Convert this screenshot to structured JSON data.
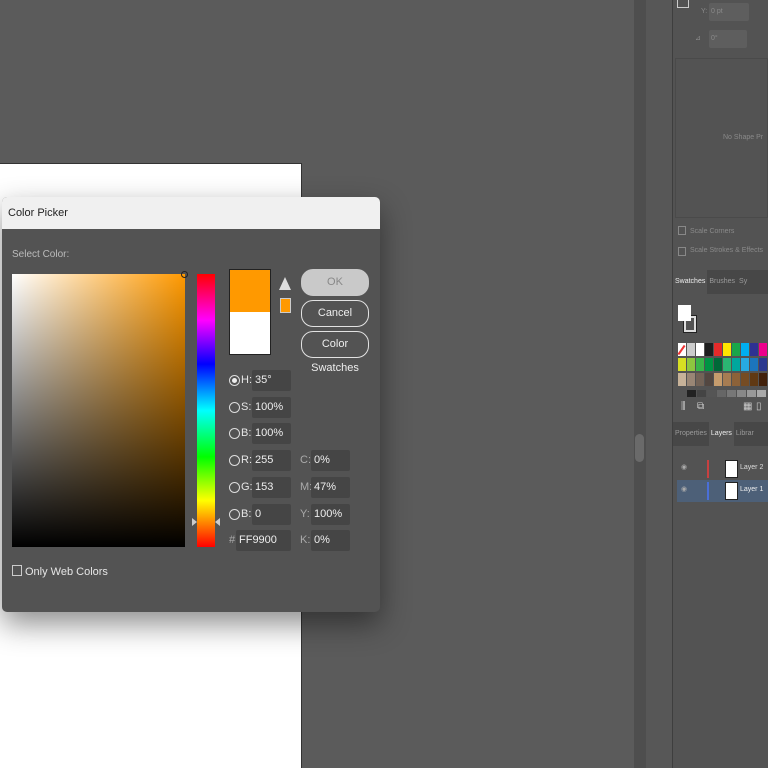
{
  "dialog": {
    "title": "Color Picker",
    "select_label": "Select Color:",
    "current_color": "#ff9900",
    "previous_color": "#ffffff",
    "buttons": {
      "ok": "OK",
      "cancel": "Cancel",
      "swatches": "Color Swatches"
    },
    "fields": {
      "h": {
        "label": "H:",
        "value": "35°"
      },
      "s": {
        "label": "S:",
        "value": "100%"
      },
      "b": {
        "label": "B:",
        "value": "100%"
      },
      "r": {
        "label": "R:",
        "value": "255"
      },
      "g": {
        "label": "G:",
        "value": "153"
      },
      "bl": {
        "label": "B:",
        "value": "0"
      },
      "hex": {
        "label": "#",
        "value": "FF9900"
      },
      "c": {
        "label": "C:",
        "value": "0%"
      },
      "m": {
        "label": "M:",
        "value": "47%"
      },
      "y": {
        "label": "Y:",
        "value": "100%"
      },
      "k": {
        "label": "K:",
        "value": "0%"
      }
    },
    "only_web_colors": "Only Web Colors"
  },
  "panel": {
    "y_label": "Y:",
    "y_value": "0 pt",
    "angle_value": "0°",
    "no_shape": "No Shape Pr",
    "scale_corners": "Scale Corners",
    "scale_strokes": "Scale Strokes & Effects",
    "swatch_tabs": [
      "Swatches",
      "Brushes",
      "Sy"
    ],
    "layer_tabs": [
      "Properties",
      "Layers",
      "Librar"
    ],
    "layers": [
      "Layer 2",
      "Layer 1"
    ]
  }
}
